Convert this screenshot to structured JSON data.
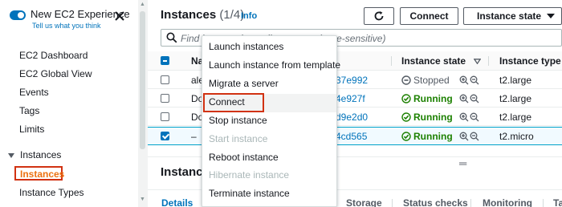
{
  "sidebar": {
    "experience_label": "New EC2 Experience",
    "tell_us": "Tell us what you think",
    "items": [
      {
        "label": "EC2 Dashboard"
      },
      {
        "label": "EC2 Global View"
      },
      {
        "label": "Events"
      },
      {
        "label": "Tags"
      },
      {
        "label": "Limits"
      }
    ],
    "section_label": "Instances",
    "section_items": [
      {
        "label": "Instances"
      },
      {
        "label": "Instance Types"
      }
    ]
  },
  "header": {
    "title": "Instances",
    "count": "(1/4)",
    "info": "Info",
    "connect_label": "Connect",
    "instance_state_label": "Instance state"
  },
  "search": {
    "placeholder": "Find instance by attribute or tag (case-sensitive)"
  },
  "table": {
    "columns": [
      "Na",
      "Instance state",
      "Instance type"
    ],
    "rows": [
      {
        "name": "ale",
        "id": "37e992",
        "state": "Stopped",
        "type": "t2.large",
        "checked": false
      },
      {
        "name": "Do",
        "id": "4e927f",
        "state": "Running",
        "type": "t2.large",
        "checked": false
      },
      {
        "name": "Do",
        "id": "d9e2d0",
        "state": "Running",
        "type": "t2.large",
        "checked": false
      },
      {
        "name": "–",
        "id": "4cd565",
        "state": "Running",
        "type": "t2.micro",
        "checked": true
      }
    ]
  },
  "detail": {
    "title": "Instance",
    "tabs": [
      "Details",
      "Storage",
      "Status checks",
      "Monitoring",
      "Ta"
    ]
  },
  "menu": {
    "items": [
      {
        "label": "Launch instances",
        "disabled": false
      },
      {
        "label": "Launch instance from template",
        "disabled": false
      },
      {
        "label": "Migrate a server",
        "disabled": false
      },
      {
        "label": "Connect",
        "disabled": false
      },
      {
        "label": "Stop instance",
        "disabled": false
      },
      {
        "label": "Start instance",
        "disabled": true
      },
      {
        "label": "Reboot instance",
        "disabled": false
      },
      {
        "label": "Hibernate instance",
        "disabled": true
      },
      {
        "label": "Terminate instance",
        "disabled": false
      }
    ]
  },
  "colors": {
    "accent": "#0073bb",
    "running": "#1d8102",
    "highlight": "#d13212",
    "active_nav": "#ec7211"
  },
  "icons": [
    "close-icon",
    "refresh-icon",
    "search-icon",
    "stopped-icon",
    "running-icon",
    "zoom-in-icon",
    "zoom-out-icon",
    "sort-down-icon"
  ]
}
